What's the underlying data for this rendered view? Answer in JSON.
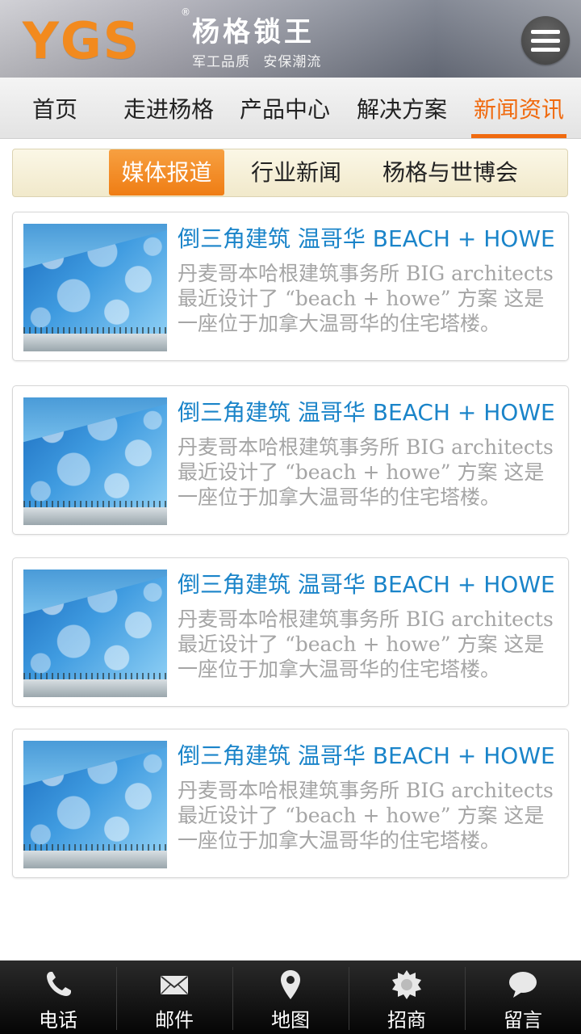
{
  "header": {
    "logo_text": "YGS",
    "logo_reg": "®",
    "brand_name": "杨格锁王",
    "slogan": "军工品质  安保潮流",
    "menu_icon": "hamburger-menu-icon"
  },
  "nav": {
    "items": [
      {
        "label": "首页"
      },
      {
        "label": "走进杨格"
      },
      {
        "label": "产品中心"
      },
      {
        "label": "解决方案"
      },
      {
        "label": "新闻资讯"
      }
    ],
    "active_index": 4
  },
  "subtabs": {
    "items": [
      {
        "label": "媒体报道"
      },
      {
        "label": "行业新闻"
      },
      {
        "label": "杨格与世博会"
      }
    ],
    "active_index": 0
  },
  "news": [
    {
      "title": "倒三角建筑 温哥华 BEACH + HOWE",
      "desc": "丹麦哥本哈根建筑事务所 BIG architects 最近设计了 “beach + howe” 方案 这是一座位于加拿大温哥华的住宅塔楼。"
    },
    {
      "title": "倒三角建筑 温哥华 BEACH + HOWE",
      "desc": "丹麦哥本哈根建筑事务所 BIG architects 最近设计了 “beach + howe” 方案 这是一座位于加拿大温哥华的住宅塔楼。"
    },
    {
      "title": "倒三角建筑 温哥华 BEACH + HOWE",
      "desc": "丹麦哥本哈根建筑事务所 BIG architects 最近设计了 “beach + howe” 方案 这是一座位于加拿大温哥华的住宅塔楼。"
    },
    {
      "title": "倒三角建筑 温哥华 BEACH + HOWE",
      "desc": "丹麦哥本哈根建筑事务所 BIG architects 最近设计了 “beach + howe” 方案 这是一座位于加拿大温哥华的住宅塔楼。"
    }
  ],
  "footer": {
    "items": [
      {
        "label": "电话",
        "icon": "phone-icon"
      },
      {
        "label": "邮件",
        "icon": "mail-icon"
      },
      {
        "label": "地图",
        "icon": "map-pin-icon"
      },
      {
        "label": "招商",
        "icon": "badge-icon"
      },
      {
        "label": "留言",
        "icon": "chat-bubble-icon"
      }
    ]
  },
  "colors": {
    "accent": "#f06a0f",
    "title_blue": "#1a84c9",
    "desc_gray": "#a5a5a5",
    "logo_orange": "#f28a1e"
  }
}
